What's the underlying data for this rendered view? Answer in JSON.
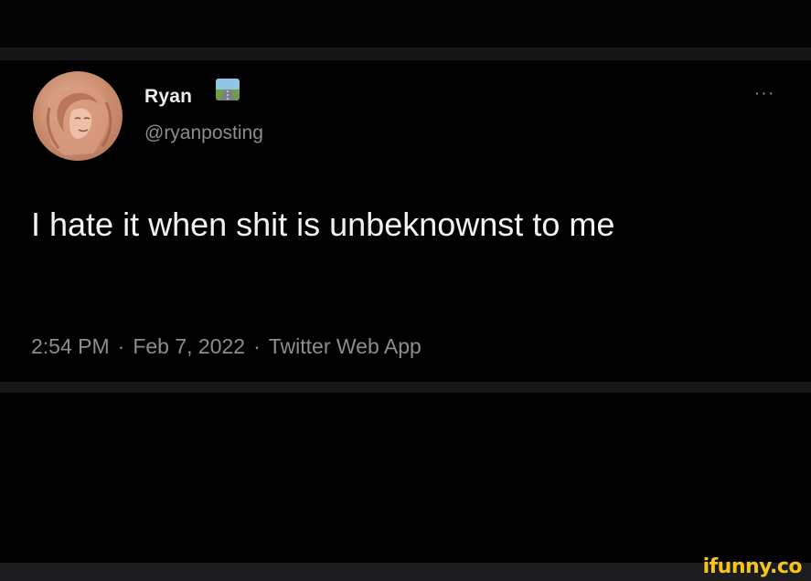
{
  "user": {
    "display_name": "Ryan",
    "handle": "@ryanposting",
    "name_emoji": "road-emoji"
  },
  "tweet": {
    "text": "I hate it when shit is unbeknownst to me",
    "time": "2:54 PM",
    "date": "Feb 7, 2022",
    "source": "Twitter Web App",
    "separator": "·",
    "more_label": "···"
  },
  "watermark": {
    "text": "ifunny.co"
  },
  "colors": {
    "background": "#000000",
    "divider": "#161617",
    "primary_text": "#f2f2f2",
    "secondary_text": "#8a8d91",
    "watermark": "#f5c518"
  }
}
